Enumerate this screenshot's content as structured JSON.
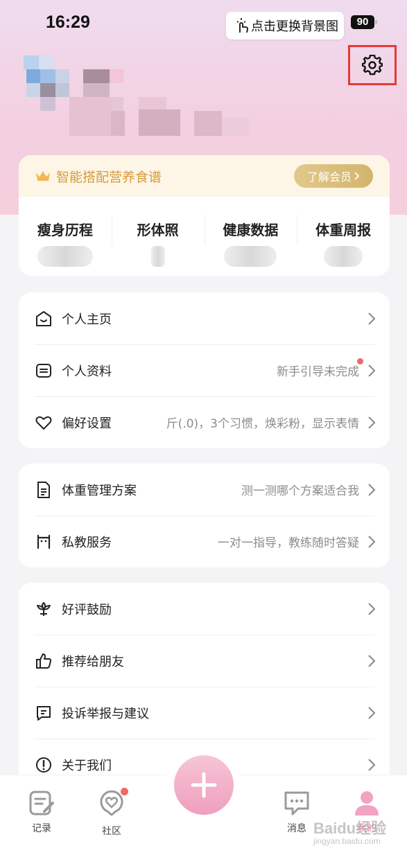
{
  "status_bar": {
    "time": "16:29",
    "battery": "90",
    "tooltip": "点击更换背景图"
  },
  "vip": {
    "title": "智能搭配营养食谱",
    "button": "了解会员"
  },
  "stats": [
    {
      "label": "瘦身历程"
    },
    {
      "label": "形体照"
    },
    {
      "label": "健康数据"
    },
    {
      "label": "体重周报"
    }
  ],
  "group1": [
    {
      "label": "个人主页",
      "value": "",
      "icon": "home-smile-icon"
    },
    {
      "label": "个人资料",
      "value": "新手引导未完成",
      "icon": "profile-card-icon"
    },
    {
      "label": "偏好设置",
      "value": "斤(.0)，3个习惯，焕彩粉，显示表情",
      "icon": "heart-icon"
    }
  ],
  "group2": [
    {
      "label": "体重管理方案",
      "value": "测一测哪个方案适合我",
      "icon": "document-icon"
    },
    {
      "label": "私教服务",
      "value": "一对一指导，教练随时答疑",
      "icon": "coach-icon"
    }
  ],
  "group3": [
    {
      "label": "好评鼓励",
      "value": "",
      "icon": "flower-icon"
    },
    {
      "label": "推荐给朋友",
      "value": "",
      "icon": "thumbs-up-icon"
    },
    {
      "label": "投诉举报与建议",
      "value": "",
      "icon": "feedback-icon"
    },
    {
      "label": "关于我们",
      "value": "",
      "icon": "info-icon"
    }
  ],
  "tabbar": {
    "record": "记录",
    "community": "社区",
    "message": "消息",
    "mine": "我的"
  },
  "watermark": {
    "text": "Baidu经验",
    "sub": "jingyan.baidu.com"
  },
  "colors": {
    "accent_pink": "#ef9fbd",
    "vip_gold": "#d89b3c",
    "highlight_red": "#e53935"
  }
}
